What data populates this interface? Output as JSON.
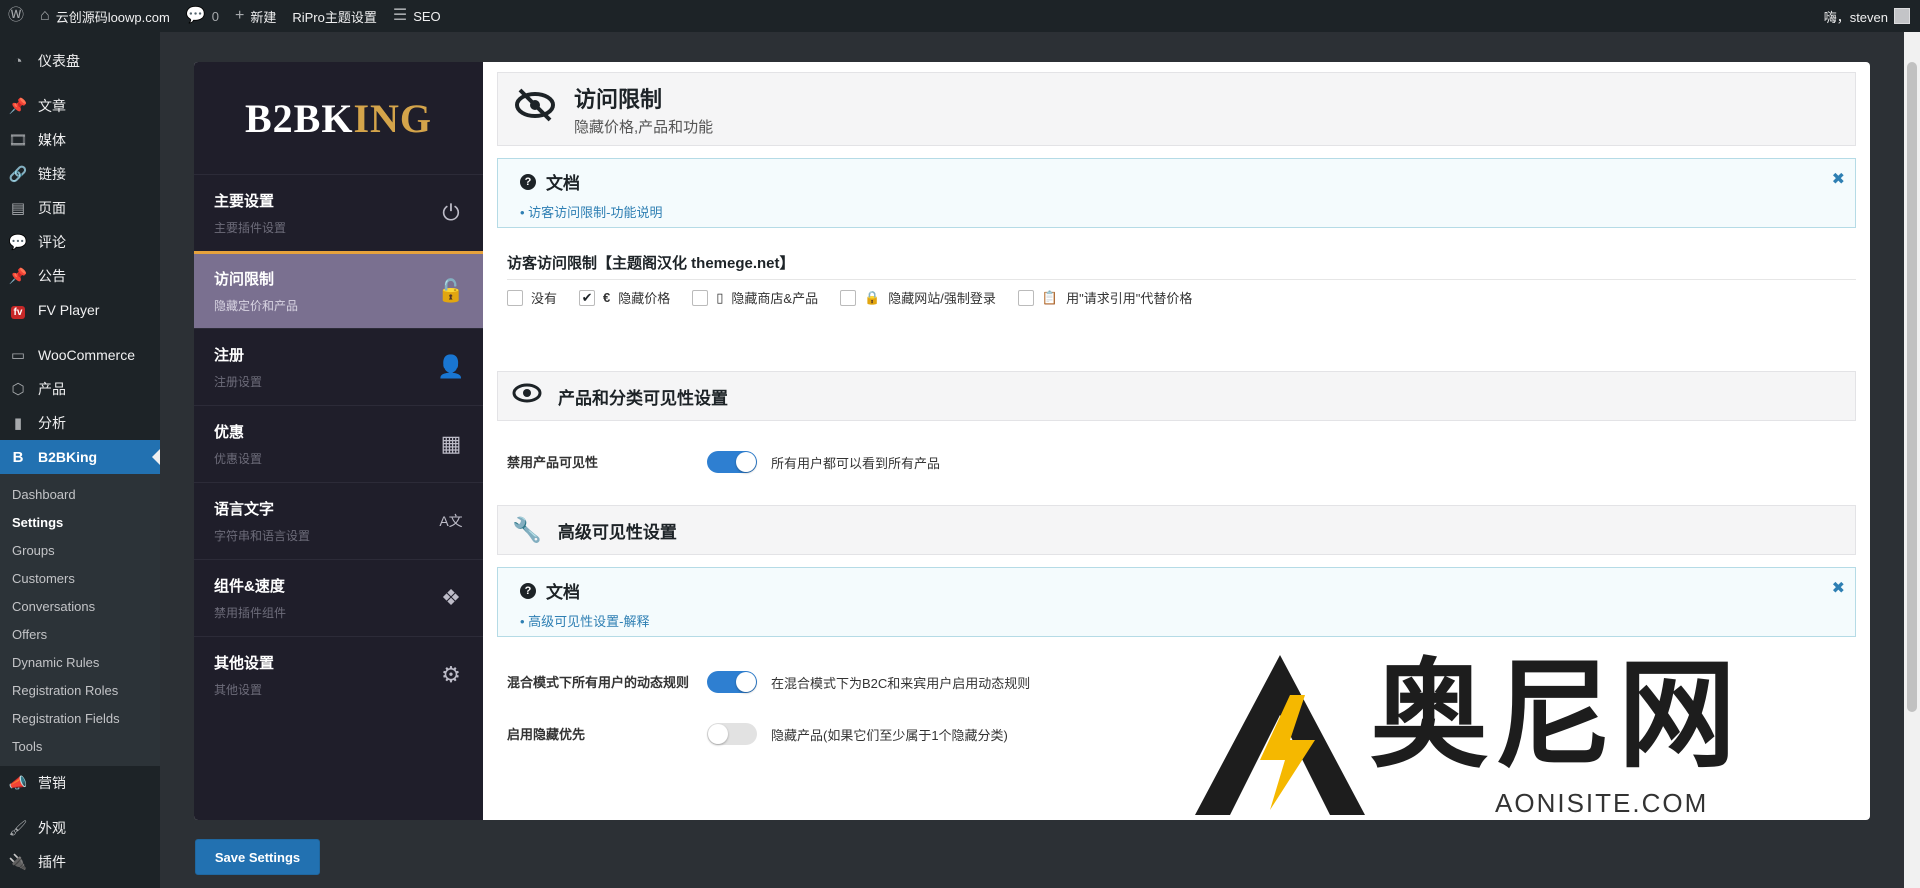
{
  "adminbar": {
    "site_name": "云创源码loowp.com",
    "comments_count": "0",
    "new_label": "新建",
    "ripro_label": "RiPro主题设置",
    "seo_label": "SEO",
    "greeting": "嗨，steven"
  },
  "adminmenu": {
    "items": [
      {
        "label": "仪表盘",
        "icon": "dashboard-icon"
      },
      {
        "label": "文章",
        "icon": "pin-icon"
      },
      {
        "label": "媒体",
        "icon": "media-icon"
      },
      {
        "label": "链接",
        "icon": "link-icon"
      },
      {
        "label": "页面",
        "icon": "page-icon"
      },
      {
        "label": "评论",
        "icon": "comment-icon"
      },
      {
        "label": "公告",
        "icon": "pin-icon"
      },
      {
        "label": "FV Player",
        "icon": "fv-icon"
      },
      {
        "label": "WooCommerce",
        "icon": "woo-icon"
      },
      {
        "label": "产品",
        "icon": "product-icon"
      },
      {
        "label": "分析",
        "icon": "chart-icon"
      },
      {
        "label": "B2BKing",
        "icon": "b2bking-icon"
      },
      {
        "label": "营销",
        "icon": "megaphone-icon"
      },
      {
        "label": "外观",
        "icon": "brush-icon"
      },
      {
        "label": "插件",
        "icon": "plugin-icon"
      }
    ],
    "fv_badge": "fv",
    "submenu": [
      "Dashboard",
      "Settings",
      "Groups",
      "Customers",
      "Conversations",
      "Offers",
      "Dynamic Rules",
      "Registration Roles",
      "Registration Fields",
      "Tools"
    ]
  },
  "b2bking": {
    "logo_main": "B2BK",
    "logo_gold": "ING",
    "nav": [
      {
        "title": "主要设置",
        "sub": "主要插件设置",
        "icon": "power-icon"
      },
      {
        "title": "访问限制",
        "sub": "隐藏定价和产品",
        "icon": "unlock-icon"
      },
      {
        "title": "注册",
        "sub": "注册设置",
        "icon": "user-plus-icon"
      },
      {
        "title": "优惠",
        "sub": "优惠设置",
        "icon": "box-icon"
      },
      {
        "title": "语言文字",
        "sub": "字符串和语言设置",
        "icon": "language-icon"
      },
      {
        "title": "组件&速度",
        "sub": "禁用插件组件",
        "icon": "cubes-icon"
      },
      {
        "title": "其他设置",
        "sub": "其他设置",
        "icon": "gear-icon"
      }
    ]
  },
  "main": {
    "header_title": "访问限制",
    "header_sub": "隐藏价格,产品和功能",
    "doc1_title": "文档",
    "doc1_link": "访客访问限制-功能说明",
    "field_title": "访客访问限制【主题阁汉化 themege.net】",
    "options": [
      {
        "label": "没有",
        "checked": false,
        "icon": ""
      },
      {
        "label": "隐藏价格",
        "checked": true,
        "icon": "€"
      },
      {
        "label": "隐藏商店&产品",
        "checked": false,
        "icon": "▯"
      },
      {
        "label": "隐藏网站/强制登录",
        "checked": false,
        "icon": "🔒"
      },
      {
        "label": "用\"请求引用\"代替价格",
        "checked": false,
        "icon": "📋"
      }
    ],
    "section1_title": "产品和分类可见性设置",
    "disable_visibility_label": "禁用产品可见性",
    "disable_visibility_desc": "所有用户都可以看到所有产品",
    "section2_title": "高级可见性设置",
    "doc2_title": "文档",
    "doc2_link": "高级可见性设置-解释",
    "hybrid_label": "混合模式下所有用户的动态规则",
    "hybrid_desc": "在混合模式下为B2C和来宾用户启用动态规则",
    "hidden_priority_label": "启用隐藏优先",
    "hidden_priority_desc": "隐藏产品(如果它们至少属于1个隐藏分类)"
  },
  "save_button": "Save Settings",
  "watermark": {
    "text": "奥尼网",
    "sub": "AONISITE.COM"
  },
  "colors": {
    "accent": "#2271b1",
    "active_nav": "#7a7090",
    "gold": "#e6a23c"
  }
}
